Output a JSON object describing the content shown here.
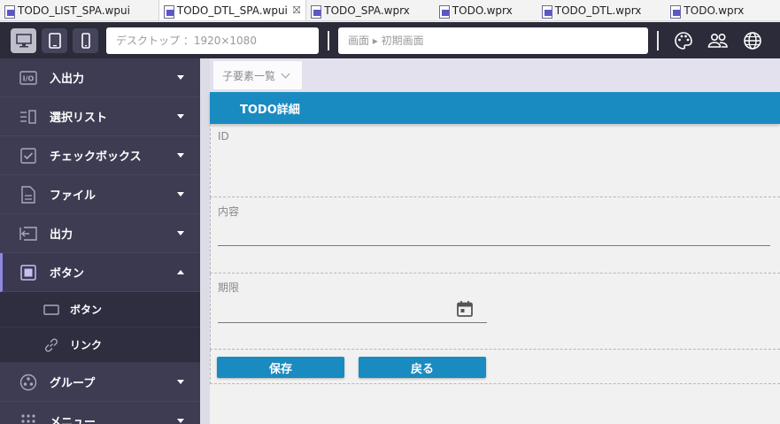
{
  "tabs": [
    {
      "label": "TODO_LIST_SPA.wpui",
      "active": false
    },
    {
      "label": "TODO_DTL_SPA.wpui",
      "active": true
    },
    {
      "label": "TODO_SPA.wprx",
      "active": false
    },
    {
      "label": "TODO.wprx",
      "active": false
    },
    {
      "label": "TODO_DTL.wprx",
      "active": false
    },
    {
      "label": "TODO.wprx",
      "active": false
    }
  ],
  "tab_close_glyph": "⛝",
  "toolbar": {
    "device_placeholder": "デスクトップ ：1920×1080",
    "screen_path": "画面 ▸ 初期画面"
  },
  "sidebar": {
    "items": [
      {
        "label": "入出力",
        "icon": "io-icon"
      },
      {
        "label": "選択リスト",
        "icon": "select-list-icon"
      },
      {
        "label": "チェックボックス",
        "icon": "checkbox-icon"
      },
      {
        "label": "ファイル",
        "icon": "file-icon"
      },
      {
        "label": "出力",
        "icon": "output-icon"
      },
      {
        "label": "ボタン",
        "icon": "button-icon",
        "open": true
      }
    ],
    "sub_items": [
      {
        "label": "ボタン",
        "icon": "button-shape-icon"
      },
      {
        "label": "リンク",
        "icon": "link-icon"
      }
    ],
    "after_items": [
      {
        "label": "グループ",
        "icon": "group-icon"
      },
      {
        "label": "メニュー",
        "icon": "menu-icon"
      }
    ]
  },
  "canvas": {
    "child_list_label": "子要素一覧",
    "header_title": "TODO詳細",
    "fields": {
      "id_label": "ID",
      "content_label": "内容",
      "deadline_label": "期限"
    },
    "buttons": {
      "save": "保存",
      "back": "戻る"
    }
  },
  "colors": {
    "header": "#1a8bc1",
    "sidebar": "#3d3c52",
    "toolbar": "#2b2b39",
    "accent": "#8f88e0"
  }
}
